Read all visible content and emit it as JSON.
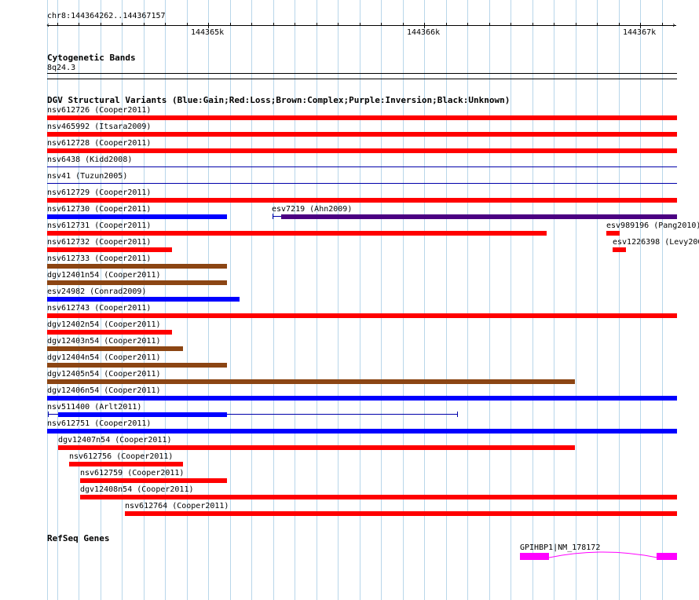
{
  "ruler": {
    "location": "chr8:144364262..144367157",
    "ticks": [
      "144365k",
      "144366k",
      "144367k"
    ]
  },
  "cytobands": {
    "title": "Cytogenetic Bands",
    "band": "8q24.3"
  },
  "dgv": {
    "title": "DGV Structural Variants (Blue:Gain;Red:Loss;Brown:Complex;Purple:Inversion;Black:Unknown)",
    "colors": {
      "gain": "#0000ff",
      "loss": "#ff0000",
      "complex": "#8b4513",
      "inversion": "#4b0082",
      "unknown": "#000000",
      "thin": "#0000aa"
    },
    "features": [
      {
        "label": "nsv612726 (Cooper2011)"
      },
      {
        "label": "nsv465992 (Itsara2009)"
      },
      {
        "label": "nsv612728 (Cooper2011)"
      },
      {
        "label": "nsv6438 (Kidd2008)"
      },
      {
        "label": "nsv41 (Tuzun2005)"
      },
      {
        "label": "nsv612729 (Cooper2011)"
      },
      {
        "label": "nsv612730 (Cooper2011)"
      },
      {
        "label": "esv7219 (Ahn2009)"
      },
      {
        "label": "nsv612731 (Cooper2011)"
      },
      {
        "label": "esv989196 (Pang2010)"
      },
      {
        "label": "nsv612732 (Cooper2011)"
      },
      {
        "label": "esv1226398 (Levy2007)"
      },
      {
        "label": "nsv612733 (Cooper2011)"
      },
      {
        "label": "dgv12401n54 (Cooper2011)"
      },
      {
        "label": "esv24982 (Conrad2009)"
      },
      {
        "label": "nsv612743 (Cooper2011)"
      },
      {
        "label": "dgv12402n54 (Cooper2011)"
      },
      {
        "label": "dgv12403n54 (Cooper2011)"
      },
      {
        "label": "dgv12404n54 (Cooper2011)"
      },
      {
        "label": "dgv12405n54 (Cooper2011)"
      },
      {
        "label": "dgv12406n54 (Cooper2011)"
      },
      {
        "label": "nsv511400 (Arlt2011)"
      },
      {
        "label": "nsv612751 (Cooper2011)"
      },
      {
        "label": "dgv12407n54 (Cooper2011)"
      },
      {
        "label": "nsv612756 (Cooper2011)"
      },
      {
        "label": "nsv612759 (Cooper2011)"
      },
      {
        "label": "dgv12408n54 (Cooper2011)"
      },
      {
        "label": "nsv612764 (Cooper2011)"
      }
    ]
  },
  "refseq": {
    "title": "RefSeq Genes",
    "gene_label": "GPIHBP1|NM_178172",
    "gene_color": "#ff00ff"
  }
}
